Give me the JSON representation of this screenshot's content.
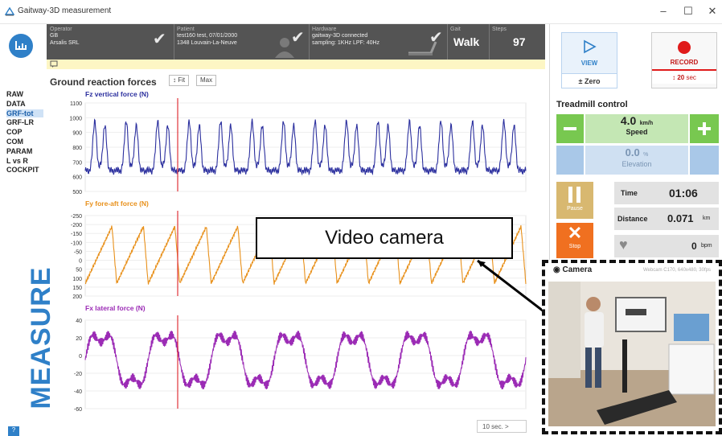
{
  "window": {
    "title": "Gaitway-3D measurement",
    "minimize": "–",
    "maximize": "☐",
    "close": "✕"
  },
  "nav": {
    "items": [
      "RAW",
      "DATA",
      "GRF-tot",
      "GRF-LR",
      "COP",
      "COM",
      "PARAM",
      "L vs R",
      "COCKPIT"
    ],
    "active": "GRF-tot",
    "section": "MEASURE",
    "help": "?"
  },
  "infobar": {
    "operator_label": "Operator",
    "operator_line1": "GB",
    "operator_line2": "Arsalis SRL",
    "patient_label": "Patient",
    "patient_line1": "test160 test, 07/01/2000",
    "patient_line2": "1348 Louvain-La-Neuve",
    "hardware_label": "Hardware",
    "hardware_line1": "gaitway-3D connected",
    "hardware_line2": "sampling: 1KHz  LPF: 40Hz",
    "gait_label": "Gait",
    "gait_value": "Walk",
    "steps_label": "Steps",
    "steps_value": "97"
  },
  "grf": {
    "title": "Ground reaction forces",
    "fit_label": "Fit",
    "max_label": "Max",
    "window_label": "10 sec.",
    "window_arrow": ">"
  },
  "chart_data": [
    {
      "type": "line",
      "title": "Fz vertical force (N)",
      "yticks": [
        1100,
        1000,
        900,
        800,
        700,
        600,
        500
      ],
      "ylim": [
        500,
        1100
      ],
      "color": "#2b2f9e",
      "cycles": 14,
      "pattern": "double-hump gait curve peaking near 1000 N, troughs near 630 N"
    },
    {
      "type": "line",
      "title": "Fy fore-aft force (N)",
      "yticks": [
        -250,
        -200,
        -150,
        -100,
        -50,
        0,
        50,
        100,
        150,
        200
      ],
      "ylim": [
        -250,
        200
      ],
      "inverted": true,
      "color": "#e8901a",
      "cycles": 14,
      "pattern": "sawtooth between about -200 N and 150 N"
    },
    {
      "type": "line",
      "title": "Fx lateral force (N)",
      "yticks": [
        40,
        20,
        0,
        -20,
        -40,
        -60
      ],
      "ylim": [
        -60,
        40
      ],
      "color": "#9b2bb5",
      "cycles": 7,
      "pattern": "alternating left/right oscillation between about -40 N and 30 N"
    }
  ],
  "controls": {
    "view_label": "VIEW",
    "zero_label": "Zero",
    "record_label": "RECORD",
    "record_duration": "20",
    "record_unit": "sec"
  },
  "treadmill": {
    "title": "Treadmill control",
    "speed_value": "4.0",
    "speed_unit": "km/h",
    "speed_label": "Speed",
    "elevation_value": "0.0",
    "elevation_unit": "%",
    "elevation_label": "Elevation",
    "pause_label": "Pause",
    "stop_label": "Stop",
    "time_label": "Time",
    "time_value": "01:06",
    "distance_label": "Distance",
    "distance_value": "0.071",
    "distance_unit": "km",
    "hr_value": "0",
    "hr_unit": "bpm"
  },
  "camera": {
    "title": "Camera",
    "source": "Webcam C170, 640x480, 30fps"
  },
  "annotation": {
    "label": "Video camera"
  },
  "colors": {
    "accent": "#2f80c8",
    "record_red": "#e01b1b",
    "treadmill_green": "#78c850",
    "stop_orange": "#f07020",
    "pause_tan": "#d8b870"
  }
}
